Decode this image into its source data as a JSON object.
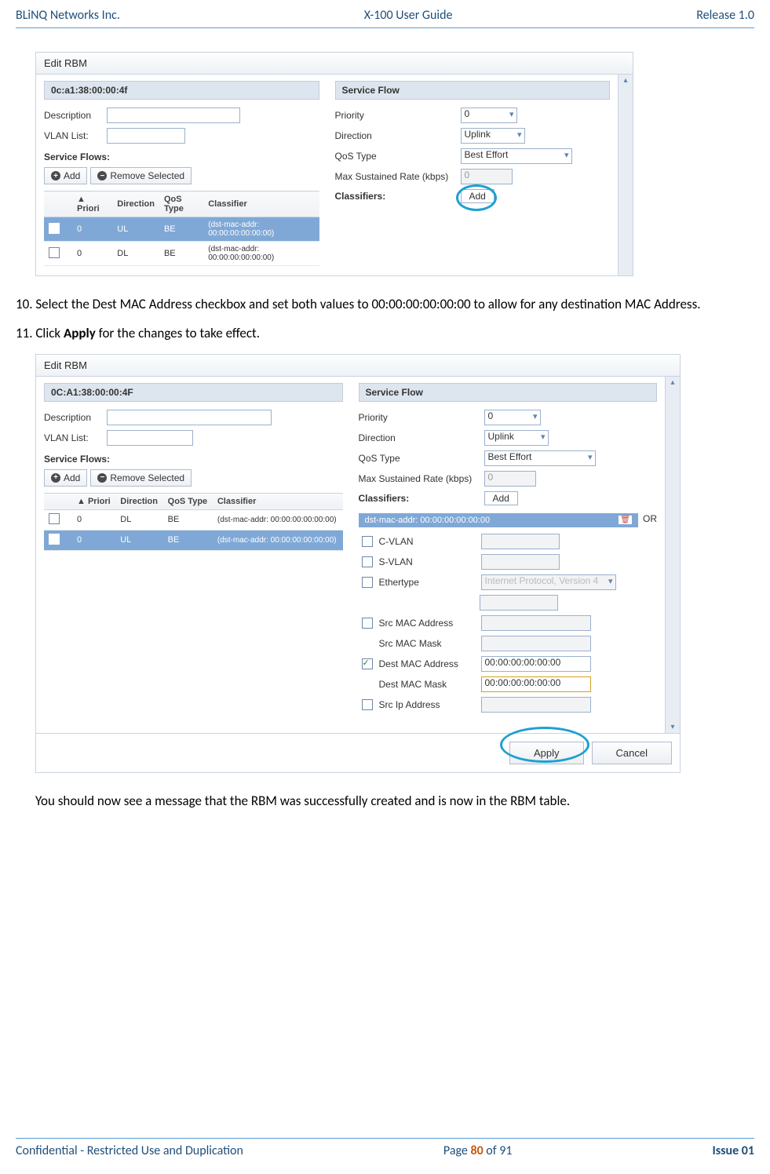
{
  "header": {
    "left": "BLiNQ Networks Inc.",
    "center": "X-100 User Guide",
    "right": "Release 1.0"
  },
  "footer": {
    "left": "Confidential - Restricted Use and Duplication",
    "center_pre": "Page ",
    "center_num": "80",
    "center_mid": " of ",
    "center_total": "91",
    "right": "Issue 01"
  },
  "body_text": {
    "step10": "10. Select the Dest MAC Address checkbox and set both values to 00:00:00:00:00:00 to allow for any destination MAC Address.",
    "step11_pre": "11. Click ",
    "step11_bold": "Apply",
    "step11_post": " for the changes to take effect.",
    "result": "You should now see a message that the RBM was successfully created and is now in the RBM table."
  },
  "ss1": {
    "title": "Edit RBM",
    "mac": "0c:a1:38:00:00:4f",
    "labels": {
      "description": "Description",
      "vlan": "VLAN List:",
      "flows_section": "Service Flows:"
    },
    "buttons": {
      "add": "Add",
      "remove": "Remove Selected",
      "classifier_add": "Add"
    },
    "table_headers": {
      "priority": "Priori",
      "direction": "Direction",
      "qos": "QoS Type",
      "classifier": "Classifier"
    },
    "rows": [
      {
        "priority": "0",
        "direction": "UL",
        "qos": "BE",
        "classifier": "(dst-mac-addr: 00:00:00:00:00:00)",
        "selected": true
      },
      {
        "priority": "0",
        "direction": "DL",
        "qos": "BE",
        "classifier": "(dst-mac-addr: 00:00:00:00:00:00)",
        "selected": false
      }
    ],
    "right_header": "Service Flow",
    "right_fields": {
      "priority_label": "Priority",
      "priority_val": "0",
      "direction_label": "Direction",
      "direction_val": "Uplink",
      "qos_label": "QoS Type",
      "qos_val": "Best Effort",
      "rate_label": "Max Sustained Rate (kbps)",
      "rate_val": "0",
      "classifiers_label": "Classifiers:"
    }
  },
  "ss2": {
    "title": "Edit RBM",
    "mac": "0C:A1:38:00:00:4F",
    "labels": {
      "description": "Description",
      "vlan": "VLAN List:",
      "flows_section": "Service Flows:"
    },
    "buttons": {
      "add": "Add",
      "remove": "Remove Selected",
      "classifier_add": "Add",
      "apply": "Apply",
      "cancel": "Cancel"
    },
    "table_headers": {
      "priority": "Priori",
      "direction": "Direction",
      "qos": "QoS Type",
      "classifier": "Classifier"
    },
    "rows": [
      {
        "priority": "0",
        "direction": "DL",
        "qos": "BE",
        "classifier": "(dst-mac-addr: 00:00:00:00:00:00)",
        "selected": false
      },
      {
        "priority": "0",
        "direction": "UL",
        "qos": "BE",
        "classifier": "(dst-mac-addr: 00:00:00:00:00:00)",
        "selected": true
      }
    ],
    "right_header": "Service Flow",
    "right_fields": {
      "priority_label": "Priority",
      "priority_val": "0",
      "direction_label": "Direction",
      "direction_val": "Uplink",
      "qos_label": "QoS Type",
      "qos_val": "Best Effort",
      "rate_label": "Max Sustained Rate (kbps)",
      "rate_val": "0",
      "classifiers_label": "Classifiers:"
    },
    "classifier_bar": {
      "text": "dst-mac-addr: 00:00:00:00:00:00",
      "or": "OR"
    },
    "classifier_fields": {
      "cvlan": "C-VLAN",
      "svlan": "S-VLAN",
      "ethertype": "Ethertype",
      "ethertype_val": "Internet Protocol, Version 4",
      "srcmac": "Src MAC Address",
      "srcmask": "Src MAC Mask",
      "dstmac": "Dest MAC Address",
      "dstmac_val": "00:00:00:00:00:00",
      "dstmask": "Dest MAC Mask",
      "dstmask_val": "00:00:00:00:00:00",
      "srcip": "Src Ip Address"
    }
  }
}
